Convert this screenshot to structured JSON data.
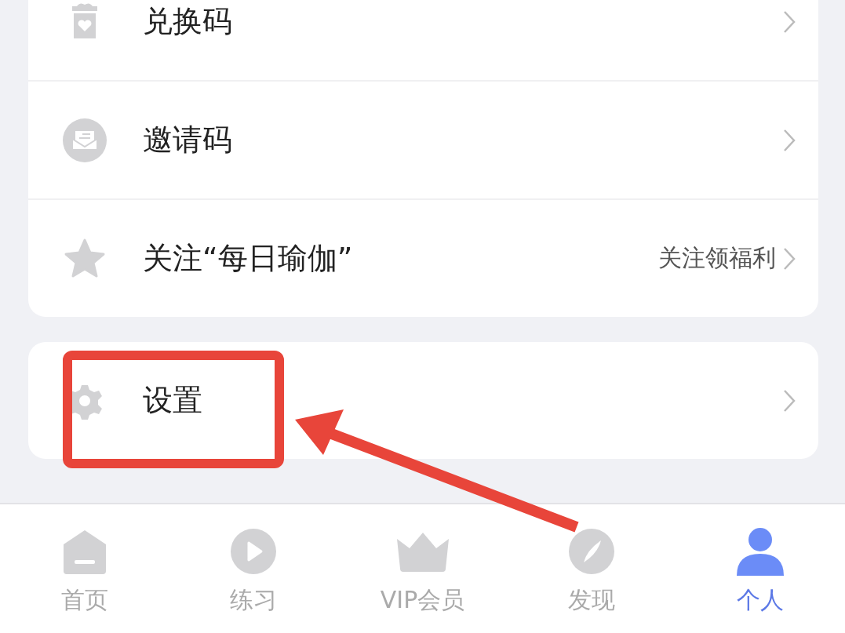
{
  "menu_groups": [
    {
      "items": [
        {
          "label": "兑换码"
        },
        {
          "label": "邀请码"
        },
        {
          "label": "关注“每日瑜伽”",
          "hint": "关注领福利"
        }
      ]
    },
    {
      "items": [
        {
          "label": "设置"
        }
      ]
    }
  ],
  "tab_bar": [
    {
      "label": "首页",
      "selected": false
    },
    {
      "label": "练习",
      "selected": false
    },
    {
      "label": "VIP会员",
      "selected": false
    },
    {
      "label": "发现",
      "selected": false
    },
    {
      "label": "个人",
      "selected": true
    }
  ]
}
